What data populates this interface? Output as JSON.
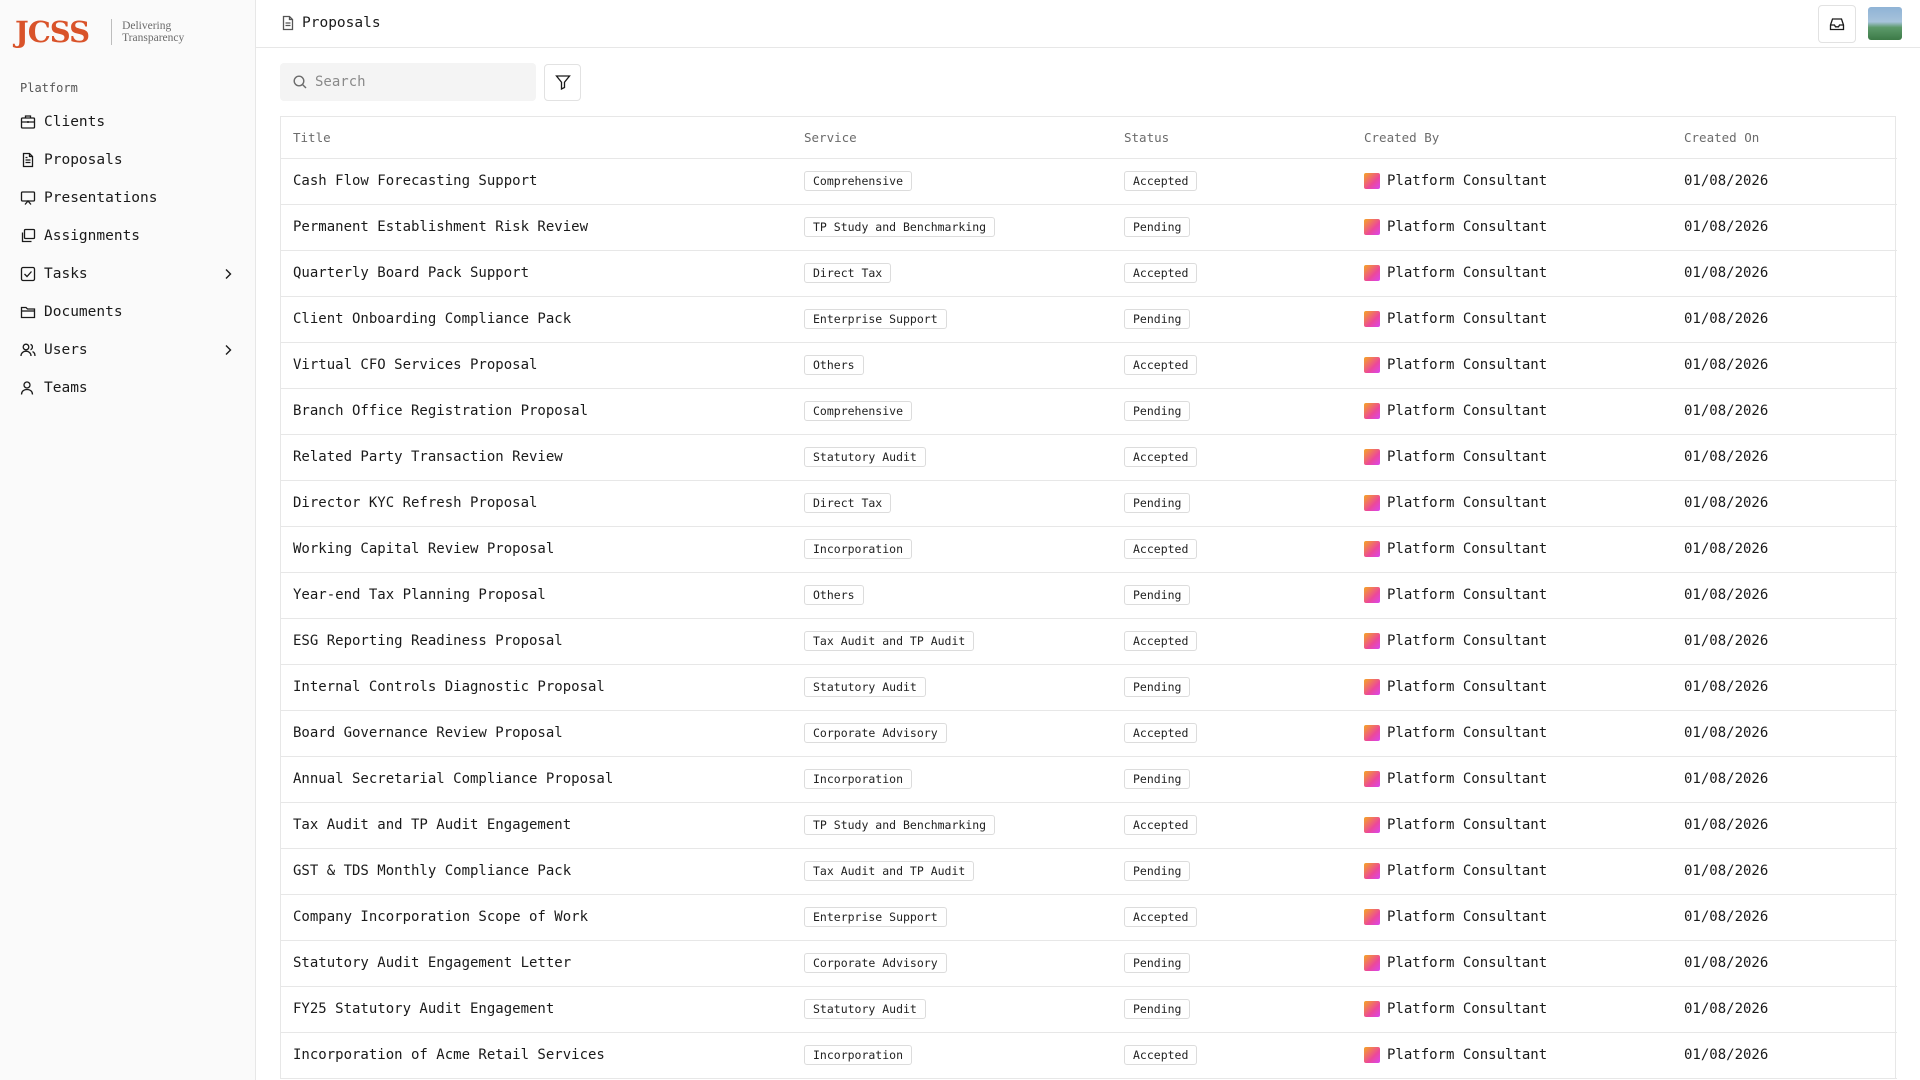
{
  "brand": {
    "logo": "JCSS",
    "tagline_1": "Delivering",
    "tagline_2": "Transparency"
  },
  "sidebar": {
    "section_label": "Platform",
    "items": [
      {
        "label": "Clients",
        "icon": "building-icon",
        "has_chevron": false
      },
      {
        "label": "Proposals",
        "icon": "document-icon",
        "has_chevron": false
      },
      {
        "label": "Presentations",
        "icon": "presentation-icon",
        "has_chevron": false
      },
      {
        "label": "Assignments",
        "icon": "layers-icon",
        "has_chevron": false
      },
      {
        "label": "Tasks",
        "icon": "checkbox-icon",
        "has_chevron": true
      },
      {
        "label": "Documents",
        "icon": "folder-icon",
        "has_chevron": false
      },
      {
        "label": "Users",
        "icon": "users-icon",
        "has_chevron": true
      },
      {
        "label": "Teams",
        "icon": "team-icon",
        "has_chevron": false
      }
    ]
  },
  "header": {
    "breadcrumb": "Proposals"
  },
  "search": {
    "placeholder": "Search"
  },
  "table": {
    "columns": [
      "Title",
      "Service",
      "Status",
      "Created By",
      "Created On"
    ],
    "rows": [
      {
        "title": "Cash Flow Forecasting Support",
        "service": "Comprehensive",
        "status": "Accepted",
        "created_by": "Platform Consultant",
        "created_on": "01/08/2026"
      },
      {
        "title": "Permanent Establishment Risk Review",
        "service": "TP Study and Benchmarking",
        "status": "Pending",
        "created_by": "Platform Consultant",
        "created_on": "01/08/2026"
      },
      {
        "title": "Quarterly Board Pack Support",
        "service": "Direct Tax",
        "status": "Accepted",
        "created_by": "Platform Consultant",
        "created_on": "01/08/2026"
      },
      {
        "title": "Client Onboarding Compliance Pack",
        "service": "Enterprise Support",
        "status": "Pending",
        "created_by": "Platform Consultant",
        "created_on": "01/08/2026"
      },
      {
        "title": "Virtual CFO Services Proposal",
        "service": "Others",
        "status": "Accepted",
        "created_by": "Platform Consultant",
        "created_on": "01/08/2026"
      },
      {
        "title": "Branch Office Registration Proposal",
        "service": "Comprehensive",
        "status": "Pending",
        "created_by": "Platform Consultant",
        "created_on": "01/08/2026"
      },
      {
        "title": "Related Party Transaction Review",
        "service": "Statutory Audit",
        "status": "Accepted",
        "created_by": "Platform Consultant",
        "created_on": "01/08/2026"
      },
      {
        "title": "Director KYC Refresh Proposal",
        "service": "Direct Tax",
        "status": "Pending",
        "created_by": "Platform Consultant",
        "created_on": "01/08/2026"
      },
      {
        "title": "Working Capital Review Proposal",
        "service": "Incorporation",
        "status": "Accepted",
        "created_by": "Platform Consultant",
        "created_on": "01/08/2026"
      },
      {
        "title": "Year-end Tax Planning Proposal",
        "service": "Others",
        "status": "Pending",
        "created_by": "Platform Consultant",
        "created_on": "01/08/2026"
      },
      {
        "title": "ESG Reporting Readiness Proposal",
        "service": "Tax Audit and TP Audit",
        "status": "Accepted",
        "created_by": "Platform Consultant",
        "created_on": "01/08/2026"
      },
      {
        "title": "Internal Controls Diagnostic Proposal",
        "service": "Statutory Audit",
        "status": "Pending",
        "created_by": "Platform Consultant",
        "created_on": "01/08/2026"
      },
      {
        "title": "Board Governance Review Proposal",
        "service": "Corporate Advisory",
        "status": "Accepted",
        "created_by": "Platform Consultant",
        "created_on": "01/08/2026"
      },
      {
        "title": "Annual Secretarial Compliance Proposal",
        "service": "Incorporation",
        "status": "Pending",
        "created_by": "Platform Consultant",
        "created_on": "01/08/2026"
      },
      {
        "title": "Tax Audit and TP Audit Engagement",
        "service": "TP Study and Benchmarking",
        "status": "Accepted",
        "created_by": "Platform Consultant",
        "created_on": "01/08/2026"
      },
      {
        "title": "GST & TDS Monthly Compliance Pack",
        "service": "Tax Audit and TP Audit",
        "status": "Pending",
        "created_by": "Platform Consultant",
        "created_on": "01/08/2026"
      },
      {
        "title": "Company Incorporation Scope of Work",
        "service": "Enterprise Support",
        "status": "Accepted",
        "created_by": "Platform Consultant",
        "created_on": "01/08/2026"
      },
      {
        "title": "Statutory Audit Engagement Letter",
        "service": "Corporate Advisory",
        "status": "Pending",
        "created_by": "Platform Consultant",
        "created_on": "01/08/2026"
      },
      {
        "title": "FY25 Statutory Audit Engagement",
        "service": "Statutory Audit",
        "status": "Pending",
        "created_by": "Platform Consultant",
        "created_on": "01/08/2026"
      },
      {
        "title": "Incorporation of Acme Retail Services",
        "service": "Incorporation",
        "status": "Accepted",
        "created_by": "Platform Consultant",
        "created_on": "01/08/2026"
      }
    ]
  },
  "colors": {
    "brand": "#d9532a",
    "sidebar_bg": "#fafafa",
    "border": "#e7e7e7",
    "search_bg": "#f4f4f4"
  }
}
